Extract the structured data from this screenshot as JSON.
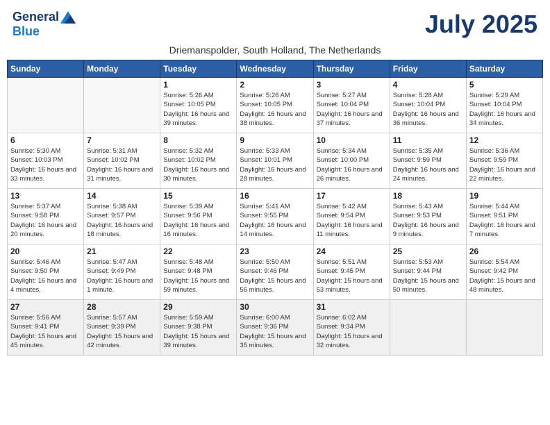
{
  "header": {
    "logo_line1": "General",
    "logo_line2": "Blue",
    "month_year": "July 2025",
    "subtitle": "Driemanspolder, South Holland, The Netherlands"
  },
  "weekdays": [
    "Sunday",
    "Monday",
    "Tuesday",
    "Wednesday",
    "Thursday",
    "Friday",
    "Saturday"
  ],
  "weeks": [
    [
      {
        "day": "",
        "info": ""
      },
      {
        "day": "",
        "info": ""
      },
      {
        "day": "1",
        "info": "Sunrise: 5:26 AM\nSunset: 10:05 PM\nDaylight: 16 hours\nand 39 minutes."
      },
      {
        "day": "2",
        "info": "Sunrise: 5:26 AM\nSunset: 10:05 PM\nDaylight: 16 hours\nand 38 minutes."
      },
      {
        "day": "3",
        "info": "Sunrise: 5:27 AM\nSunset: 10:04 PM\nDaylight: 16 hours\nand 37 minutes."
      },
      {
        "day": "4",
        "info": "Sunrise: 5:28 AM\nSunset: 10:04 PM\nDaylight: 16 hours\nand 36 minutes."
      },
      {
        "day": "5",
        "info": "Sunrise: 5:29 AM\nSunset: 10:04 PM\nDaylight: 16 hours\nand 34 minutes."
      }
    ],
    [
      {
        "day": "6",
        "info": "Sunrise: 5:30 AM\nSunset: 10:03 PM\nDaylight: 16 hours\nand 33 minutes."
      },
      {
        "day": "7",
        "info": "Sunrise: 5:31 AM\nSunset: 10:02 PM\nDaylight: 16 hours\nand 31 minutes."
      },
      {
        "day": "8",
        "info": "Sunrise: 5:32 AM\nSunset: 10:02 PM\nDaylight: 16 hours\nand 30 minutes."
      },
      {
        "day": "9",
        "info": "Sunrise: 5:33 AM\nSunset: 10:01 PM\nDaylight: 16 hours\nand 28 minutes."
      },
      {
        "day": "10",
        "info": "Sunrise: 5:34 AM\nSunset: 10:00 PM\nDaylight: 16 hours\nand 26 minutes."
      },
      {
        "day": "11",
        "info": "Sunrise: 5:35 AM\nSunset: 9:59 PM\nDaylight: 16 hours\nand 24 minutes."
      },
      {
        "day": "12",
        "info": "Sunrise: 5:36 AM\nSunset: 9:59 PM\nDaylight: 16 hours\nand 22 minutes."
      }
    ],
    [
      {
        "day": "13",
        "info": "Sunrise: 5:37 AM\nSunset: 9:58 PM\nDaylight: 16 hours\nand 20 minutes."
      },
      {
        "day": "14",
        "info": "Sunrise: 5:38 AM\nSunset: 9:57 PM\nDaylight: 16 hours\nand 18 minutes."
      },
      {
        "day": "15",
        "info": "Sunrise: 5:39 AM\nSunset: 9:56 PM\nDaylight: 16 hours\nand 16 minutes."
      },
      {
        "day": "16",
        "info": "Sunrise: 5:41 AM\nSunset: 9:55 PM\nDaylight: 16 hours\nand 14 minutes."
      },
      {
        "day": "17",
        "info": "Sunrise: 5:42 AM\nSunset: 9:54 PM\nDaylight: 16 hours\nand 11 minutes."
      },
      {
        "day": "18",
        "info": "Sunrise: 5:43 AM\nSunset: 9:53 PM\nDaylight: 16 hours\nand 9 minutes."
      },
      {
        "day": "19",
        "info": "Sunrise: 5:44 AM\nSunset: 9:51 PM\nDaylight: 16 hours\nand 7 minutes."
      }
    ],
    [
      {
        "day": "20",
        "info": "Sunrise: 5:46 AM\nSunset: 9:50 PM\nDaylight: 16 hours\nand 4 minutes."
      },
      {
        "day": "21",
        "info": "Sunrise: 5:47 AM\nSunset: 9:49 PM\nDaylight: 16 hours\nand 1 minute."
      },
      {
        "day": "22",
        "info": "Sunrise: 5:48 AM\nSunset: 9:48 PM\nDaylight: 15 hours\nand 59 minutes."
      },
      {
        "day": "23",
        "info": "Sunrise: 5:50 AM\nSunset: 9:46 PM\nDaylight: 15 hours\nand 56 minutes."
      },
      {
        "day": "24",
        "info": "Sunrise: 5:51 AM\nSunset: 9:45 PM\nDaylight: 15 hours\nand 53 minutes."
      },
      {
        "day": "25",
        "info": "Sunrise: 5:53 AM\nSunset: 9:44 PM\nDaylight: 15 hours\nand 50 minutes."
      },
      {
        "day": "26",
        "info": "Sunrise: 5:54 AM\nSunset: 9:42 PM\nDaylight: 15 hours\nand 48 minutes."
      }
    ],
    [
      {
        "day": "27",
        "info": "Sunrise: 5:56 AM\nSunset: 9:41 PM\nDaylight: 15 hours\nand 45 minutes."
      },
      {
        "day": "28",
        "info": "Sunrise: 5:57 AM\nSunset: 9:39 PM\nDaylight: 15 hours\nand 42 minutes."
      },
      {
        "day": "29",
        "info": "Sunrise: 5:59 AM\nSunset: 9:38 PM\nDaylight: 15 hours\nand 39 minutes."
      },
      {
        "day": "30",
        "info": "Sunrise: 6:00 AM\nSunset: 9:36 PM\nDaylight: 15 hours\nand 35 minutes."
      },
      {
        "day": "31",
        "info": "Sunrise: 6:02 AM\nSunset: 9:34 PM\nDaylight: 15 hours\nand 32 minutes."
      },
      {
        "day": "",
        "info": ""
      },
      {
        "day": "",
        "info": ""
      }
    ]
  ]
}
